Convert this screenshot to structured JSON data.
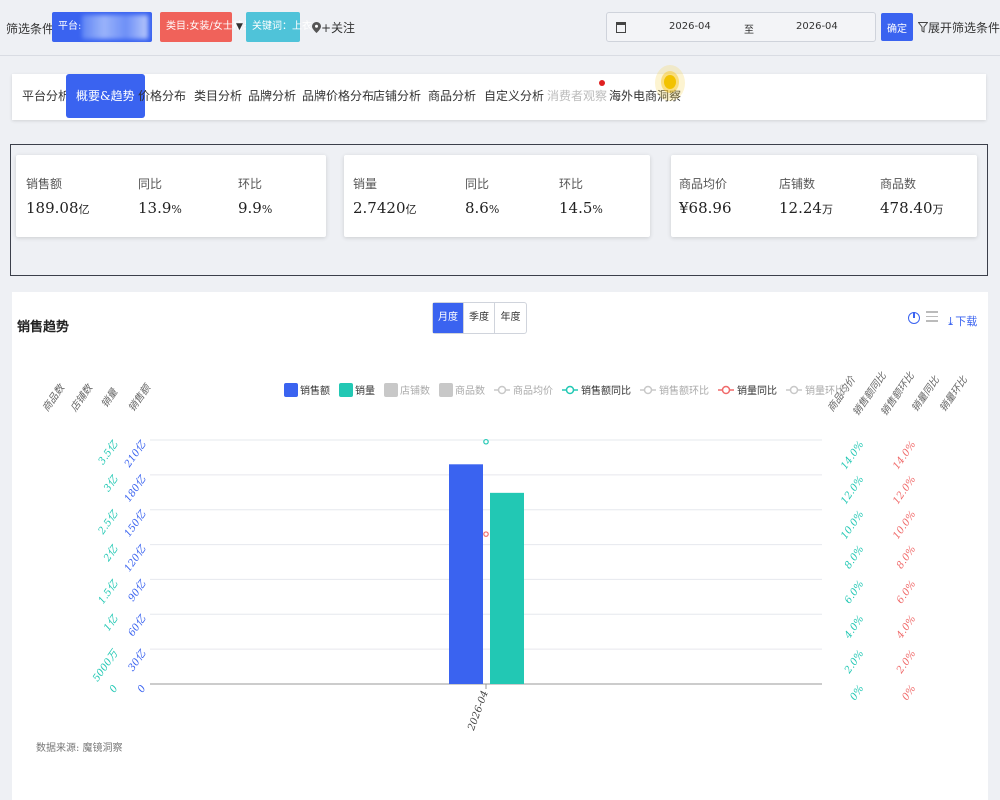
{
  "filter": {
    "label": "筛选条件:",
    "platform": "平台:",
    "category": "类目:女装/女士精品",
    "keyword": "关键词：上衣",
    "follow": "+关注",
    "date_start": "2026-04",
    "date_to": "至",
    "date_end": "2026-04",
    "confirm": "确定",
    "expand": "展开筛选条件"
  },
  "tabs": [
    {
      "label": "平台分析"
    },
    {
      "label": "概要&趋势"
    },
    {
      "label": "价格分布"
    },
    {
      "label": "类目分析"
    },
    {
      "label": "品牌分析"
    },
    {
      "label": "品牌价格分布"
    },
    {
      "label": "店铺分析"
    },
    {
      "label": "商品分析"
    },
    {
      "label": "自定义分析"
    },
    {
      "label": "消费者观察"
    },
    {
      "label": "海外电商洞察"
    }
  ],
  "stats": {
    "sales": {
      "label": "销售额",
      "value": "189.08",
      "unit": "亿"
    },
    "sales_yoy": {
      "label": "同比",
      "value": "13.9",
      "unit": "%"
    },
    "sales_mom": {
      "label": "环比",
      "value": "9.9",
      "unit": "%"
    },
    "volume": {
      "label": "销量",
      "value": "2.7420",
      "unit": "亿"
    },
    "volume_yoy": {
      "label": "同比",
      "value": "8.6",
      "unit": "%"
    },
    "volume_mom": {
      "label": "环比",
      "value": "14.5",
      "unit": "%"
    },
    "avg_price": {
      "label": "商品均价",
      "value": "¥68.96",
      "unit": ""
    },
    "shops": {
      "label": "店铺数",
      "value": "12.24",
      "unit": "万"
    },
    "products": {
      "label": "商品数",
      "value": "478.40",
      "unit": "万"
    }
  },
  "chart_panel": {
    "title": "销售趋势",
    "periods": [
      "月度",
      "季度",
      "年度"
    ],
    "active_period": "月度",
    "download": "下载",
    "source": "数据来源: 魔镜洞察"
  },
  "chart_data": {
    "type": "bar",
    "categories": [
      "2026-04"
    ],
    "series": [
      {
        "name": "销售额",
        "type": "bar",
        "axis": "销售额",
        "values": [
          189.08
        ],
        "color": "#3a63f0",
        "visible": true
      },
      {
        "name": "销量",
        "type": "bar",
        "axis": "销量",
        "values": [
          2.742
        ],
        "color": "#22c8b4",
        "visible": true
      },
      {
        "name": "店铺数",
        "type": "bar",
        "visible": false
      },
      {
        "name": "商品数",
        "type": "bar",
        "visible": false
      },
      {
        "name": "商品均价",
        "type": "line",
        "visible": false
      },
      {
        "name": "销售额同比",
        "type": "line",
        "axis": "销售额同比",
        "values": [
          13.9
        ],
        "color": "#22c8b4",
        "visible": true
      },
      {
        "name": "销售额环比",
        "type": "line",
        "visible": false
      },
      {
        "name": "销量同比",
        "type": "line",
        "axis": "销量同比",
        "values": [
          8.6
        ],
        "color": "#f06a6a",
        "visible": true
      },
      {
        "name": "销量环比",
        "type": "line",
        "visible": false
      }
    ],
    "axis_names": {
      "left": [
        "商品数",
        "店铺数",
        "销量",
        "销售额"
      ],
      "right": [
        "商品均价",
        "销售额同比",
        "销售额环比",
        "销量同比",
        "销量环比"
      ]
    },
    "axes": {
      "sales": {
        "label": "销售额",
        "ticks": [
          "0",
          "30亿",
          "60亿",
          "90亿",
          "120亿",
          "150亿",
          "180亿",
          "210亿"
        ],
        "max": 210,
        "color": "#3a63f0"
      },
      "volume": {
        "label": "销量",
        "ticks": [
          "0",
          "5000万",
          "1亿",
          "1.5亿",
          "2亿",
          "2.5亿",
          "3亿",
          "3.5亿"
        ],
        "max": 3.5,
        "color": "#22c8b4"
      },
      "sales_yoy": {
        "label": "销售额同比",
        "ticks": [
          "0%",
          "2.0%",
          "4.0%",
          "6.0%",
          "8.0%",
          "10.0%",
          "12.0%",
          "14.0%"
        ],
        "max": 14,
        "color": "#22c8b4"
      },
      "volume_yoy": {
        "label": "销量同比",
        "ticks": [
          "0%",
          "2.0%",
          "4.0%",
          "6.0%",
          "8.0%",
          "10.0%",
          "12.0%",
          "14.0%"
        ],
        "max": 14,
        "color": "#f06a6a"
      }
    },
    "legend_position": "top-center",
    "grid": true
  }
}
